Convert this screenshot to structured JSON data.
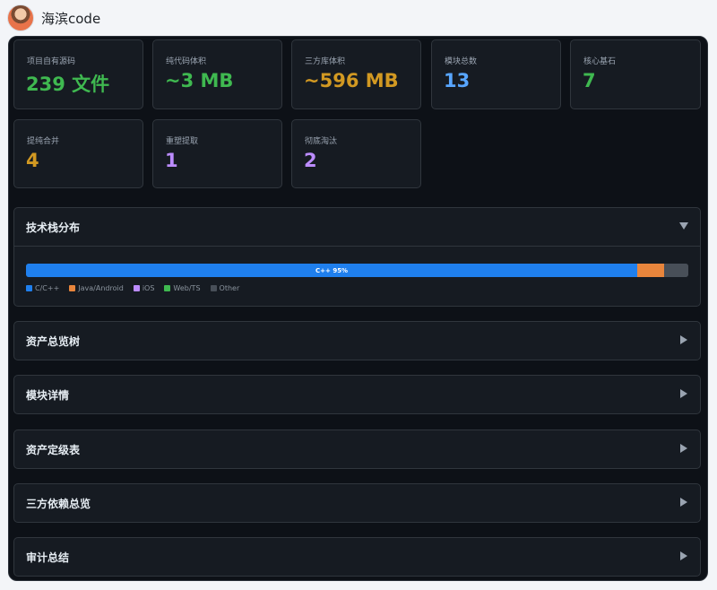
{
  "user": {
    "name": "海滨code"
  },
  "stats": [
    {
      "label": "项目自有源码",
      "value": "239 文件",
      "color": "#3fb950"
    },
    {
      "label": "纯代码体积",
      "value": "~3 MB",
      "color": "#3fb950"
    },
    {
      "label": "三方库体积",
      "value": "~596 MB",
      "color": "#d29922"
    },
    {
      "label": "模块总数",
      "value": "13",
      "color": "#58a6ff"
    },
    {
      "label": "核心基石",
      "value": "7",
      "color": "#3fb950"
    },
    {
      "label": "提纯合并",
      "value": "4",
      "color": "#d29922"
    },
    {
      "label": "重塑提取",
      "value": "1",
      "color": "#bc8cff"
    },
    {
      "label": "彻底淘汰",
      "value": "2",
      "color": "#bc8cff"
    }
  ],
  "tech_stack": {
    "title": "技术栈分布",
    "expanded_icon": "triangle-down-icon",
    "bar_label": "C++ 95%",
    "segments": [
      {
        "name": "C/C++",
        "fraction": 0.923,
        "color": "#1f7fed"
      },
      {
        "name": "Java/Android",
        "fraction": 0.04,
        "color": "#e8853c"
      },
      {
        "name": "iOS",
        "fraction": 0.0,
        "color": "#bc8cff"
      },
      {
        "name": "Web/TS",
        "fraction": 0.0,
        "color": "#3fb950"
      },
      {
        "name": "Other",
        "fraction": 0.037,
        "color": "#484f58"
      }
    ]
  },
  "sections": [
    {
      "title": "资产总览树",
      "icon": "triangle-right-icon"
    },
    {
      "title": "模块详情",
      "icon": "triangle-right-icon"
    },
    {
      "title": "资产定级表",
      "icon": "triangle-right-icon"
    },
    {
      "title": "三方依赖总览",
      "icon": "triangle-right-icon"
    },
    {
      "title": "审计总结",
      "icon": "triangle-right-icon"
    }
  ]
}
